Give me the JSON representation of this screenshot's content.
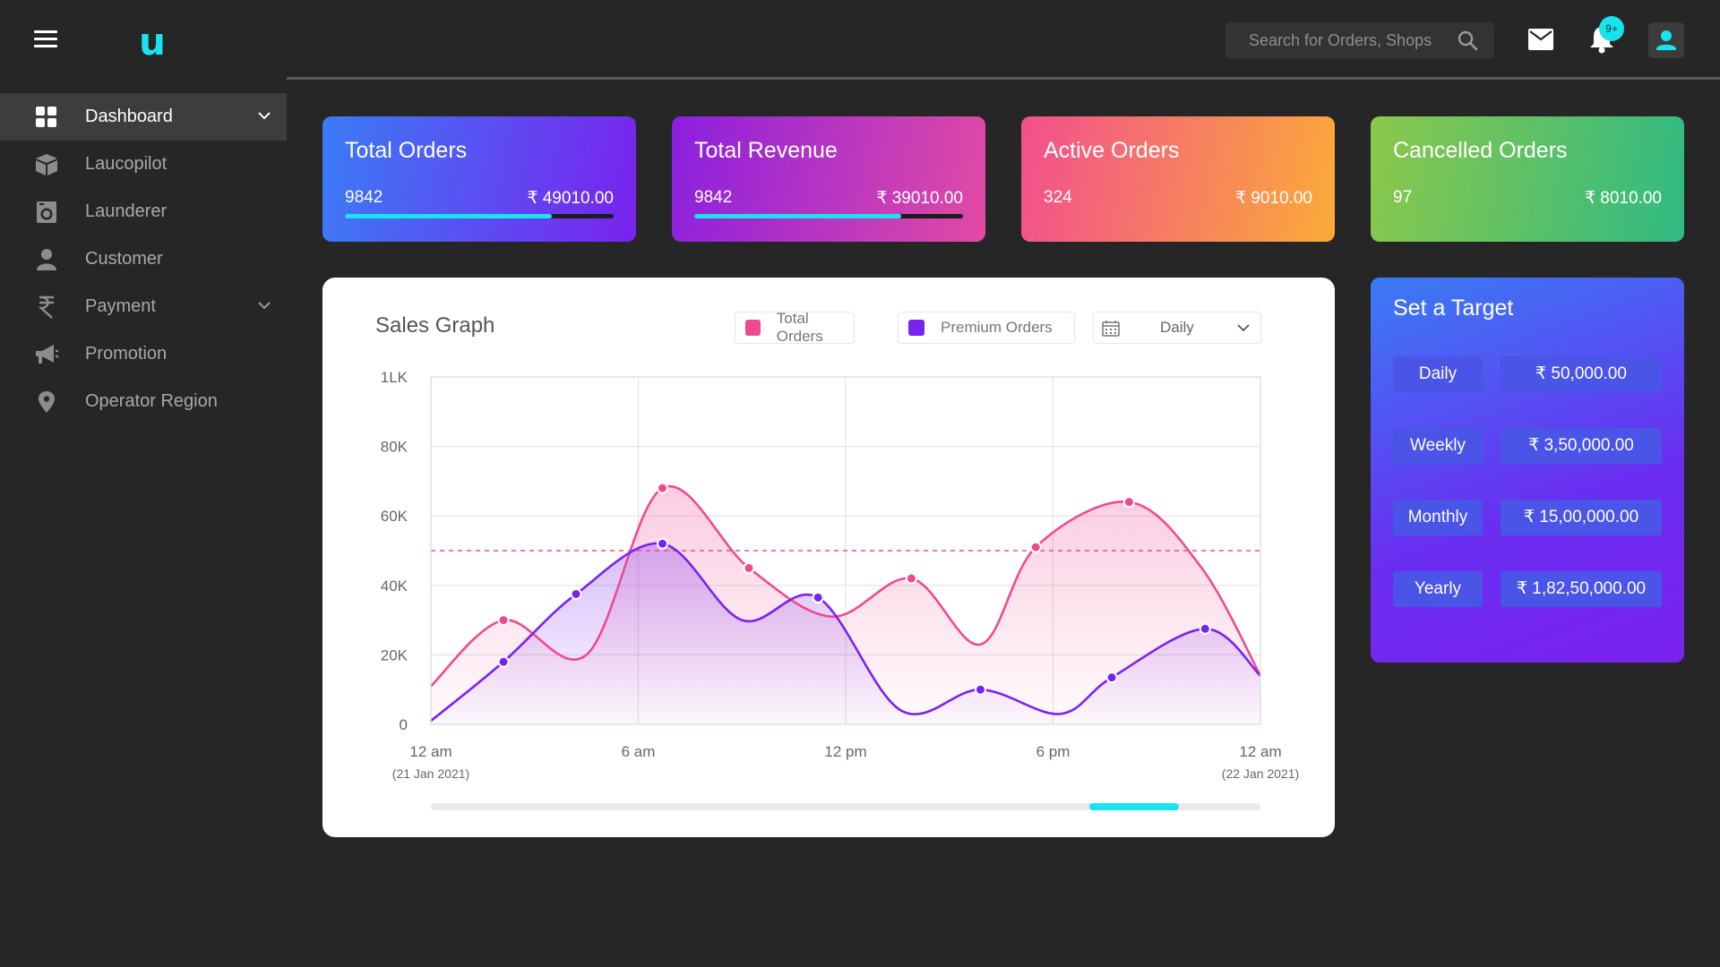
{
  "app": {
    "logo": "u"
  },
  "topbar": {
    "search_placeholder": "Search for Orders, Shops",
    "notification_badge": "9+",
    "icons": [
      "hamburger-icon",
      "search-icon",
      "mail-icon",
      "bell-icon",
      "user-icon"
    ]
  },
  "sidebar": {
    "items": [
      {
        "label": "Dashboard",
        "icon": "dashboard-icon",
        "active": true,
        "expandable": true
      },
      {
        "label": "Laucopilot",
        "icon": "box-icon",
        "active": false,
        "expandable": false
      },
      {
        "label": "Launderer",
        "icon": "washing-machine-icon",
        "active": false,
        "expandable": false
      },
      {
        "label": "Customer",
        "icon": "person-icon",
        "active": false,
        "expandable": false
      },
      {
        "label": "Payment",
        "icon": "rupee-icon",
        "active": false,
        "expandable": true
      },
      {
        "label": "Promotion",
        "icon": "megaphone-icon",
        "active": false,
        "expandable": false
      },
      {
        "label": "Operator Region",
        "icon": "map-pin-icon",
        "active": false,
        "expandable": false
      }
    ]
  },
  "cards": [
    {
      "title": "Total Orders",
      "count": "9842",
      "amount": "₹ 49010.00",
      "progress": 0.77
    },
    {
      "title": "Total Revenue",
      "count": "9842",
      "amount": "₹ 39010.00",
      "progress": 0.77
    },
    {
      "title": "Active Orders",
      "count": "324",
      "amount": "₹ 9010.00"
    },
    {
      "title": "Cancelled Orders",
      "count": "97",
      "amount": "₹ 8010.00"
    }
  ],
  "graph": {
    "title": "Sales Graph",
    "legend": [
      {
        "label": "Total Orders",
        "color": "#ef4a91"
      },
      {
        "label": "Premium Orders",
        "color": "#7a22ee"
      }
    ],
    "period": "Daily",
    "scroll_position": 0.89
  },
  "chart_data": {
    "type": "line",
    "y_ticks": [
      "1LK",
      "80K",
      "60K",
      "40K",
      "20K",
      "0"
    ],
    "ylim": [
      0,
      100000
    ],
    "x_ticks": [
      {
        "label": "12 am",
        "sub": "(21 Jan 2021)"
      },
      {
        "label": "6 am",
        "sub": ""
      },
      {
        "label": "12 pm",
        "sub": ""
      },
      {
        "label": "6 pm",
        "sub": ""
      },
      {
        "label": "12 am",
        "sub": "(22 Jan 2021)"
      }
    ],
    "xlim": [
      0,
      24
    ],
    "target_line": 50000,
    "grid": true,
    "series": [
      {
        "name": "Total Orders",
        "color": "#ef4a91",
        "points": [
          [
            0,
            11000
          ],
          [
            2.1,
            30000
          ],
          [
            4.5,
            20000
          ],
          [
            6.7,
            68000
          ],
          [
            9.2,
            45000
          ],
          [
            11.6,
            31000
          ],
          [
            13.9,
            42000
          ],
          [
            15.9,
            23000
          ],
          [
            17.5,
            51000
          ],
          [
            20.2,
            64000
          ],
          [
            22.3,
            45000
          ],
          [
            24,
            14000
          ]
        ],
        "markers": [
          [
            2.1,
            30000
          ],
          [
            6.7,
            68000
          ],
          [
            9.2,
            45000
          ],
          [
            13.9,
            42000
          ],
          [
            17.5,
            51000
          ],
          [
            20.2,
            64000
          ]
        ]
      },
      {
        "name": "Premium Orders",
        "color": "#7a22ee",
        "points": [
          [
            0,
            1000
          ],
          [
            2.1,
            18000
          ],
          [
            4.2,
            37500
          ],
          [
            6.7,
            52000
          ],
          [
            9.0,
            30000
          ],
          [
            11.2,
            36500
          ],
          [
            13.6,
            4000
          ],
          [
            15.9,
            10000
          ],
          [
            18.2,
            3000
          ],
          [
            19.7,
            13500
          ],
          [
            22.4,
            27500
          ],
          [
            24,
            14000
          ]
        ],
        "markers": [
          [
            2.1,
            18000
          ],
          [
            4.2,
            37500
          ],
          [
            6.7,
            52000
          ],
          [
            11.2,
            36500
          ],
          [
            15.9,
            10000
          ],
          [
            19.7,
            13500
          ],
          [
            22.4,
            27500
          ]
        ]
      }
    ]
  },
  "target": {
    "title": "Set a Target",
    "rows": [
      {
        "label": "Daily",
        "value": "₹ 50,000.00"
      },
      {
        "label": "Weekly",
        "value": "₹ 3,50,000.00"
      },
      {
        "label": "Monthly",
        "value": "₹ 15,00,000.00"
      },
      {
        "label": "Yearly",
        "value": "₹ 1,82,50,000.00"
      }
    ]
  }
}
